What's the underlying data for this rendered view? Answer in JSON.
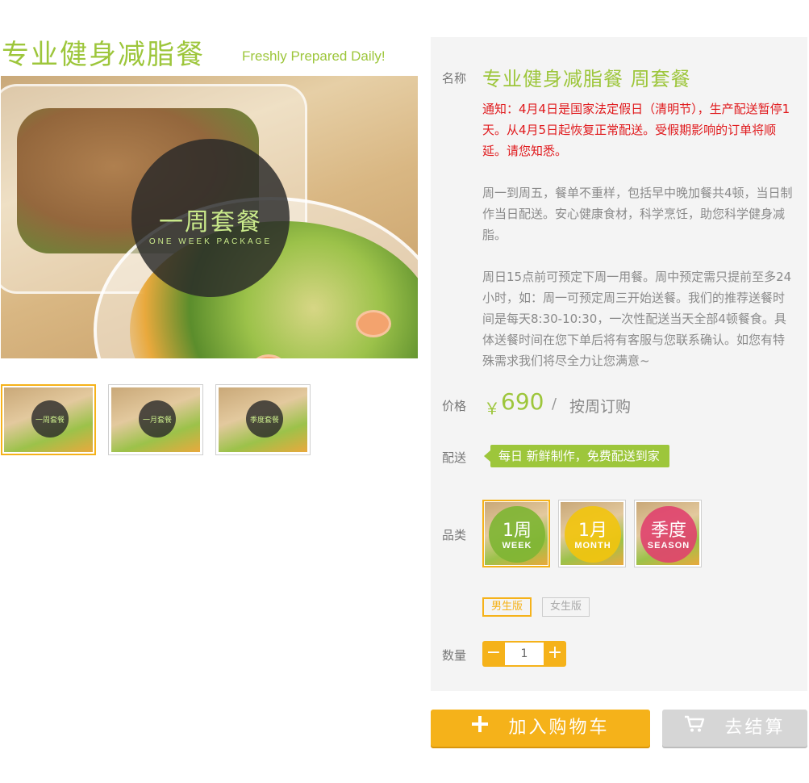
{
  "header": {
    "title": "专业健身减脂餐",
    "subtitle": "Freshly Prepared Daily!"
  },
  "gallery": {
    "main_overlay_title": "一周套餐",
    "main_overlay_subtitle": "ONE WEEK PACKAGE",
    "thumbnails": [
      {
        "label": "一周套餐",
        "active": true
      },
      {
        "label": "一月套餐",
        "active": false
      },
      {
        "label": "季度套餐",
        "active": false
      }
    ]
  },
  "product": {
    "name_label": "名称",
    "name": "专业健身减脂餐 周套餐",
    "notice": "通知：4月4日是国家法定假日（清明节），生产配送暂停1天。从4月5日起恢复正常配送。受假期影响的订单将顺延。请您知悉。",
    "description_1": "周一到周五，餐单不重样，包括早中晚加餐共4顿，当日制作当日配送。安心健康食材，科学烹饪，助您科学健身减脂。",
    "description_2": "周日15点前可预定下周一用餐。周中预定需只提前至多24小时，如：周一可预定周三开始送餐。我们的推荐送餐时间是每天8:30-10:30，一次性配送当天全部4顿餐食。具体送餐时间在您下单后将有客服与您联系确认。如您有特殊需求我们将尽全力让您满意~",
    "price_label": "价格",
    "price_symbol": "￥",
    "price": "690",
    "price_sep": "/",
    "price_unit": "按周订购",
    "delivery_label": "配送",
    "delivery_tag": "每日 新鲜制作，免费配送到家",
    "category_label": "品类",
    "categories": [
      {
        "main": "1周",
        "sub": "WEEK",
        "color": "#7fb534",
        "active": true
      },
      {
        "main": "1月",
        "sub": "MONTH",
        "color": "#f1c40f",
        "active": false
      },
      {
        "main": "季度",
        "sub": "SEASON",
        "color": "#e0416e",
        "active": false
      }
    ],
    "versions": [
      {
        "label": "男生版",
        "active": true
      },
      {
        "label": "女生版",
        "active": false
      }
    ],
    "quantity_label": "数量",
    "quantity": "1",
    "qty_minus": "−",
    "qty_plus": "+"
  },
  "actions": {
    "add_to_cart": "加入购物车",
    "checkout": "去结算"
  },
  "colors": {
    "brand_green": "#9dc63b",
    "accent_orange": "#f5b21a",
    "notice_red": "#e0191c"
  }
}
